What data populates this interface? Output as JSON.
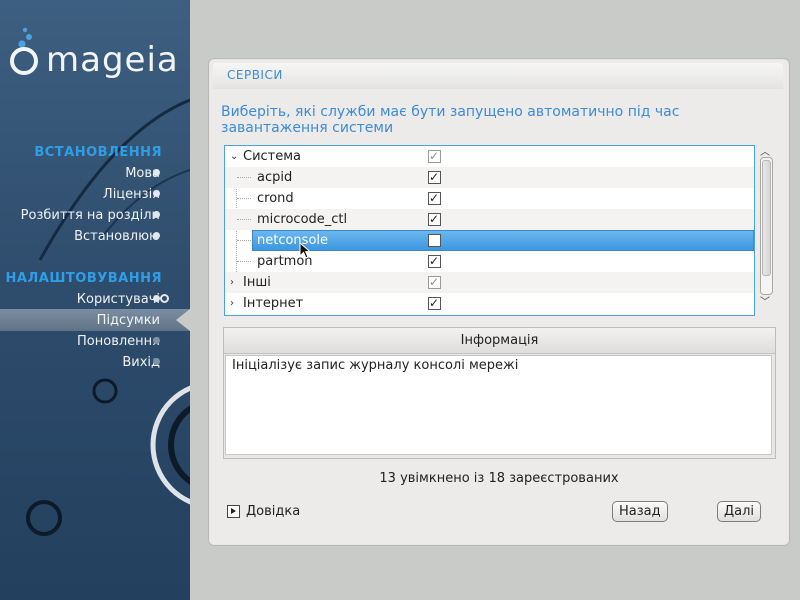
{
  "brand": {
    "logo_text": "mageia"
  },
  "sidebar": {
    "section_install": "ВСТАНОВЛЕННЯ",
    "install_items": [
      {
        "label": "Мова"
      },
      {
        "label": "Ліцензія"
      },
      {
        "label": "Розбиття на розділи"
      },
      {
        "label": "Встановлюю"
      }
    ],
    "section_config": "НАЛАШТОВУВАННЯ",
    "config_items": [
      {
        "label": "Користувачі"
      },
      {
        "label": "Підсумки"
      },
      {
        "label": "Поновлення"
      },
      {
        "label": "Вихід"
      }
    ]
  },
  "panel": {
    "title": "СЕРВІСИ",
    "subtitle": "Виберіть, які служби має бути запущено автоматично під час завантаження системи",
    "tree": [
      {
        "label": "Система",
        "expanded": true,
        "checked": true,
        "dim": true
      },
      {
        "label": "acpid",
        "checked": true
      },
      {
        "label": "crond",
        "checked": true
      },
      {
        "label": "microcode_ctl",
        "checked": true
      },
      {
        "label": "netconsole",
        "checked": false,
        "selected": true
      },
      {
        "label": "partmon",
        "checked": true
      },
      {
        "label": "Інші",
        "expanded": false,
        "checked": true,
        "dim": true
      },
      {
        "label": "Інтернет",
        "expanded": false,
        "checked": true
      }
    ],
    "info_header": "Інформація",
    "info_text": "Ініціалізує запис журналу консолі мережі",
    "status": "13 увімкнено із 18 зареєстрованих",
    "help_label": "Довідка",
    "back_label": "Назад",
    "next_label": "Далі"
  },
  "colors": {
    "accent": "#3b8bd6",
    "sidebar_heading": "#2f9ee6",
    "selection": "#4aa3e0"
  }
}
